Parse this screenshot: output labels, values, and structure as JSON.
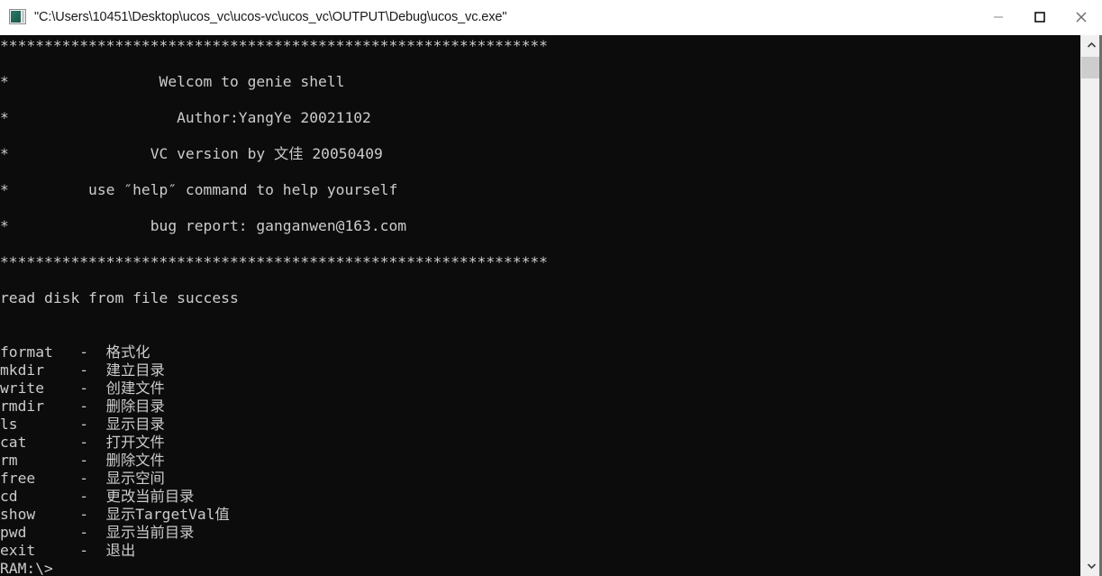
{
  "window": {
    "title": "\"C:\\Users\\10451\\Desktop\\ucos_vc\\ucos-vc\\ucos_vc\\OUTPUT\\Debug\\ucos_vc.exe\"",
    "icon": "console-app-icon",
    "titlebar_bg": "#ffffff",
    "titlebar_fg": "#1a1a1a",
    "controls": {
      "minimize_label": "Minimize",
      "maximize_label": "Maximize",
      "close_label": "Close"
    }
  },
  "console": {
    "background": "#0c0c0c",
    "foreground": "#cccccc",
    "font_size_px": 16,
    "line_height_px": 20,
    "banner": {
      "rule": "**************************************************************",
      "lines": [
        "*                 Welcom to genie shell",
        "*                   Author:YangYe 20021102",
        "*                VC version by 文佳 20050409",
        "*         use ″help″ command to help yourself",
        "*                bug report: ganganwen@163.com"
      ]
    },
    "status_line": "read disk from file success",
    "commands": [
      {
        "name": "format",
        "sep": "-",
        "desc": "格式化"
      },
      {
        "name": "mkdir",
        "sep": "-",
        "desc": "建立目录"
      },
      {
        "name": "write",
        "sep": "-",
        "desc": "创建文件"
      },
      {
        "name": "rmdir",
        "sep": "-",
        "desc": "删除目录"
      },
      {
        "name": "ls",
        "sep": "-",
        "desc": "显示目录"
      },
      {
        "name": "cat",
        "sep": "-",
        "desc": "打开文件"
      },
      {
        "name": "rm",
        "sep": "-",
        "desc": "删除文件"
      },
      {
        "name": "free",
        "sep": "-",
        "desc": "显示空间"
      },
      {
        "name": "cd",
        "sep": "-",
        "desc": "更改当前目录"
      },
      {
        "name": "show",
        "sep": "-",
        "desc": "显示TargetVal值"
      },
      {
        "name": "pwd",
        "sep": "-",
        "desc": "显示当前目录"
      },
      {
        "name": "exit",
        "sep": "-",
        "desc": "退出"
      }
    ],
    "prompt": "RAM:\\>",
    "full_text": "**************************************************************\n\n*                 Welcom to genie shell\n\n*                   Author:YangYe 20021102\n\n*                VC version by 文佳 20050409\n\n*         use ″help″ command to help yourself\n\n*                bug report: ganganwen@163.com\n\n**************************************************************\n\nread disk from file success\n\n\nformat   -  格式化\nmkdir    -  建立目录\nwrite    -  创建文件\nrmdir    -  删除目录\nls       -  显示目录\ncat      -  打开文件\nrm       -  删除文件\nfree     -  显示空间\ncd       -  更改当前目录\nshow     -  显示TargetVal值\npwd      -  显示当前目录\nexit     -  退出\nRAM:\\>"
  },
  "scrollbar": {
    "up_arrow": "chevron-up-icon",
    "down_arrow": "chevron-down-icon",
    "thumb_label": "scrollbar-thumb",
    "track_color": "#f0f0f0",
    "thumb_color": "#cdcdcd"
  }
}
